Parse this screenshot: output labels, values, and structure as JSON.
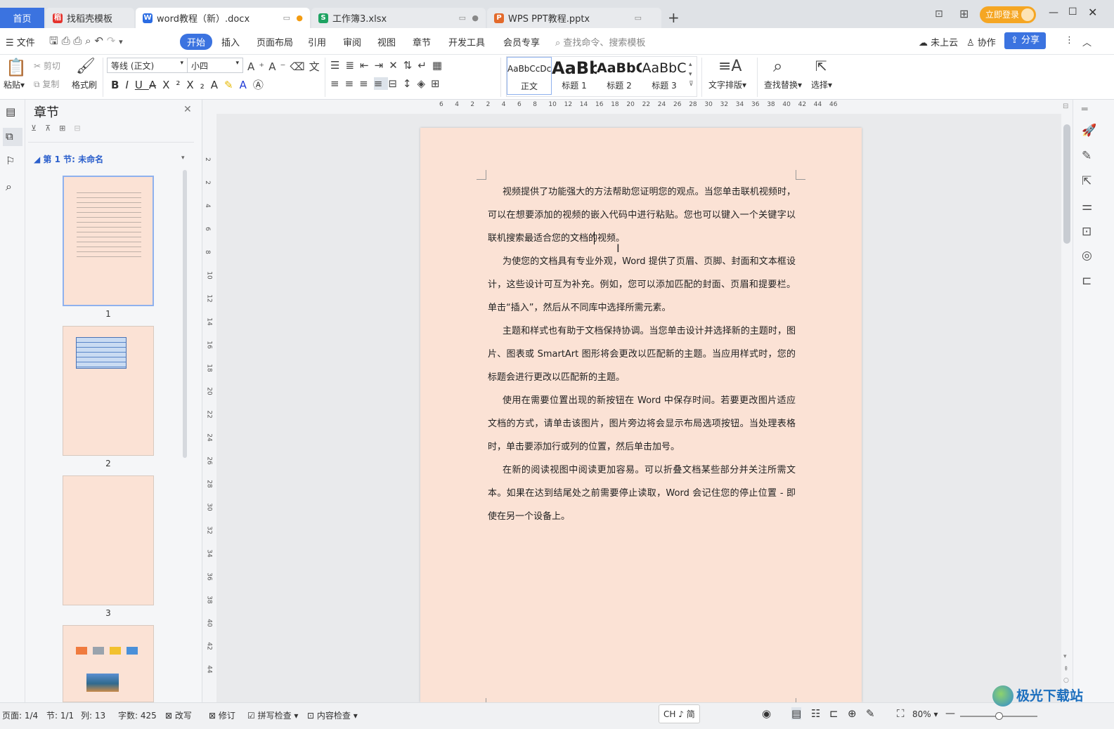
{
  "tabs": {
    "home": "首页",
    "items": [
      {
        "label": "找稻壳模板",
        "icon": "daoke-icon"
      },
      {
        "label": "word教程（新）.docx",
        "icon": "word-icon"
      },
      {
        "label": "工作簿3.xlsx",
        "icon": "excel-icon"
      },
      {
        "label": "WPS PPT教程.pptx",
        "icon": "ppt-icon"
      }
    ],
    "add": "+",
    "login": "立即登录"
  },
  "menu": {
    "file": "文件",
    "items": [
      "开始",
      "插入",
      "页面布局",
      "引用",
      "审阅",
      "视图",
      "章节",
      "开发工具",
      "会员专享"
    ],
    "search_placeholder": "查找命令、搜索模板",
    "cloud": "未上云",
    "collab": "协作",
    "share": "分享"
  },
  "ribbon": {
    "paste": "粘贴",
    "cut": "剪切",
    "copy": "复制",
    "format_painter": "格式刷",
    "font_name": "等线 (正文)",
    "font_size": "小四",
    "styles": [
      {
        "preview": "AaBbCcDc",
        "label": "正文"
      },
      {
        "preview": "AaBb",
        "label": "标题 1"
      },
      {
        "preview": "AaBbC",
        "label": "标题 2"
      },
      {
        "preview": "AaBbC",
        "label": "标题 3"
      }
    ],
    "text_layout": "文字排版",
    "find_replace": "查找替换",
    "select": "选择"
  },
  "nav": {
    "title": "章节",
    "section": "第 1 节: 未命名",
    "pages": [
      "1",
      "2",
      "3"
    ]
  },
  "ruler": {
    "h_ticks": [
      "6",
      "4",
      "2",
      "2",
      "4",
      "6",
      "8",
      "10",
      "12",
      "14",
      "16",
      "18",
      "20",
      "22",
      "24",
      "26",
      "28",
      "30",
      "32",
      "34",
      "36",
      "38",
      "40",
      "42",
      "44",
      "46"
    ],
    "v_ticks": [
      "2",
      "2",
      "4",
      "6",
      "8",
      "10",
      "12",
      "14",
      "16",
      "18",
      "20",
      "22",
      "24",
      "26",
      "28",
      "30",
      "32",
      "34",
      "36",
      "38",
      "40",
      "42",
      "44"
    ]
  },
  "document": {
    "paragraphs": [
      "视频提供了功能强大的方法帮助您证明您的观点。当您单击联机视频时，可以在想要添加的视频的嵌入代码中进行粘贴。您也可以键入一个关键字以联机搜索最适合您的文档的视频。",
      "为使您的文档具有专业外观，Word 提供了页眉、页脚、封面和文本框设计，这些设计可互为补充。例如，您可以添加匹配的封面、页眉和提要栏。单击“插入”，然后从不同库中选择所需元素。",
      "主题和样式也有助于文档保持协调。当您单击设计并选择新的主题时，图片、图表或 SmartArt 图形将会更改以匹配新的主题。当应用样式时，您的标题会进行更改以匹配新的主题。",
      "使用在需要位置出现的新按钮在 Word 中保存时间。若要更改图片适应文档的方式，请单击该图片，图片旁边将会显示布局选项按钮。当处理表格时，单击要添加行或列的位置，然后单击加号。",
      "在新的阅读视图中阅读更加容易。可以折叠文档某些部分并关注所需文本。如果在达到结尾处之前需要停止读取，Word 会记住您的停止位置 - 即使在另一个设备上。"
    ]
  },
  "status": {
    "page": "页面: 1/4",
    "section": "节: 1/1",
    "column": "列: 13",
    "words": "字数: 425",
    "overwrite": "改写",
    "revise": "修订",
    "spell": "拼写检查",
    "content_check": "内容检查",
    "ime": "CH ♪ 简",
    "zoom": "80%"
  },
  "watermark": "极光下载站",
  "colors": {
    "accent": "#3b73e0",
    "page_bg": "#fbe2d5",
    "login_btn": "#f5a623"
  }
}
